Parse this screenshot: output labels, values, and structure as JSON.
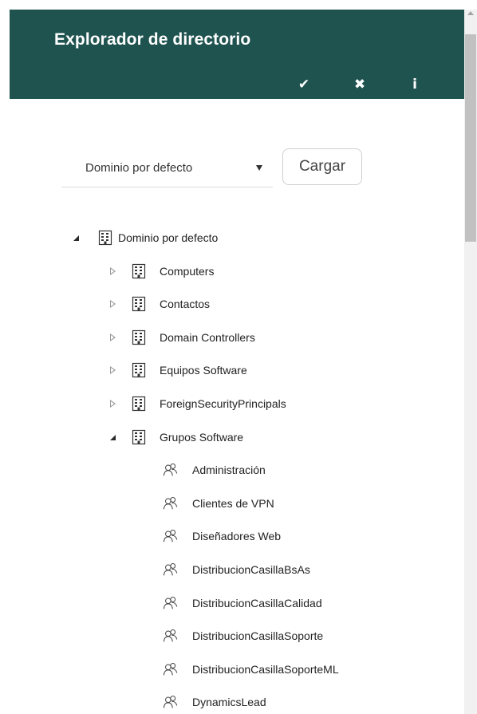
{
  "header": {
    "title": "Explorador de directorio",
    "actions": [
      {
        "icon": "check-icon",
        "glyph": "✔"
      },
      {
        "icon": "close-icon",
        "glyph": "✖"
      },
      {
        "icon": "info-icon",
        "glyph": "i"
      }
    ]
  },
  "domain_select": {
    "value": "Dominio por defecto"
  },
  "load_button": {
    "label": "Cargar"
  },
  "tree": {
    "root": {
      "label": "Dominio por defecto",
      "expanded": true,
      "icon": "building-icon"
    },
    "ous": [
      {
        "label": "Computers",
        "expanded": false,
        "icon": "building-icon"
      },
      {
        "label": "Contactos",
        "expanded": false,
        "icon": "building-icon"
      },
      {
        "label": "Domain Controllers",
        "expanded": false,
        "icon": "building-icon"
      },
      {
        "label": "Equipos Software",
        "expanded": false,
        "icon": "building-icon"
      },
      {
        "label": "ForeignSecurityPrincipals",
        "expanded": false,
        "icon": "building-icon"
      },
      {
        "label": "Grupos Software",
        "expanded": true,
        "icon": "building-icon"
      }
    ],
    "groups": [
      {
        "label": "Administración",
        "icon": "group-icon"
      },
      {
        "label": "Clientes de VPN",
        "icon": "group-icon"
      },
      {
        "label": "Diseñadores Web",
        "icon": "group-icon"
      },
      {
        "label": "DistribucionCasillaBsAs",
        "icon": "group-icon"
      },
      {
        "label": "DistribucionCasillaCalidad",
        "icon": "group-icon"
      },
      {
        "label": "DistribucionCasillaSoporte",
        "icon": "group-icon"
      },
      {
        "label": "DistribucionCasillaSoporteML",
        "icon": "group-icon"
      },
      {
        "label": "DynamicsLead",
        "icon": "group-icon"
      }
    ]
  },
  "colors": {
    "header_bg": "#1f5350",
    "header_text": "#ffffff"
  }
}
